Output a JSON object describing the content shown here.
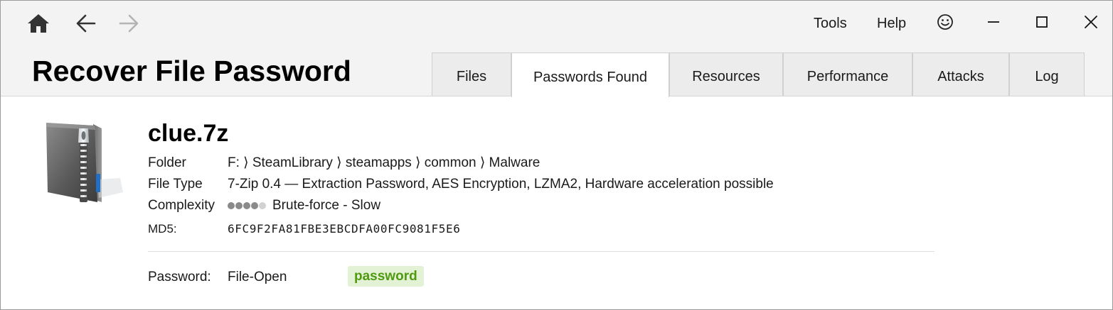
{
  "window": {
    "title": "Recover File Password"
  },
  "titlebar": {
    "icons": {
      "home": "home-icon",
      "back": "back-arrow-icon",
      "forward": "forward-arrow-icon",
      "feedback": "smiley-icon",
      "minimize": "minimize-icon",
      "maximize": "maximize-icon",
      "close": "close-icon"
    },
    "forward_disabled": true,
    "menu": {
      "tools": "Tools",
      "help": "Help"
    }
  },
  "tabs": [
    {
      "label": "Files",
      "active": false
    },
    {
      "label": "Passwords Found",
      "active": true
    },
    {
      "label": "Resources",
      "active": false
    },
    {
      "label": "Performance",
      "active": false
    },
    {
      "label": "Attacks",
      "active": false
    },
    {
      "label": "Log",
      "active": false
    }
  ],
  "file": {
    "icon": "zip-archive-icon",
    "name": "clue.7z",
    "folder_label": "Folder",
    "folder_value": "F: ⟩ SteamLibrary ⟩ steamapps ⟩ common ⟩ Malware",
    "filetype_label": "File Type",
    "filetype_value": "7-Zip 0.4 — Extraction Password, AES Encryption, LZMA2, Hardware acceleration possible",
    "complexity_label": "Complexity",
    "complexity_value": "Brute-force - Slow",
    "complexity_level": 4,
    "complexity_max": 5,
    "md5_label": "MD5:",
    "md5_value": "6FC9F2FA81FBE3EBCDFA00FC9081F5E6"
  },
  "password": {
    "label": "Password:",
    "type": "File-Open",
    "value": "password"
  },
  "colors": {
    "header_bg": "#f3f3f3",
    "tab_bg": "#ececec",
    "active_tab_bg": "#ffffff",
    "password_green": "#4f9a0f",
    "password_badge_bg": "#e3f1d5",
    "complexity_dot_on": "#8a8a8a",
    "complexity_dot_off": "#d2d2d2"
  }
}
